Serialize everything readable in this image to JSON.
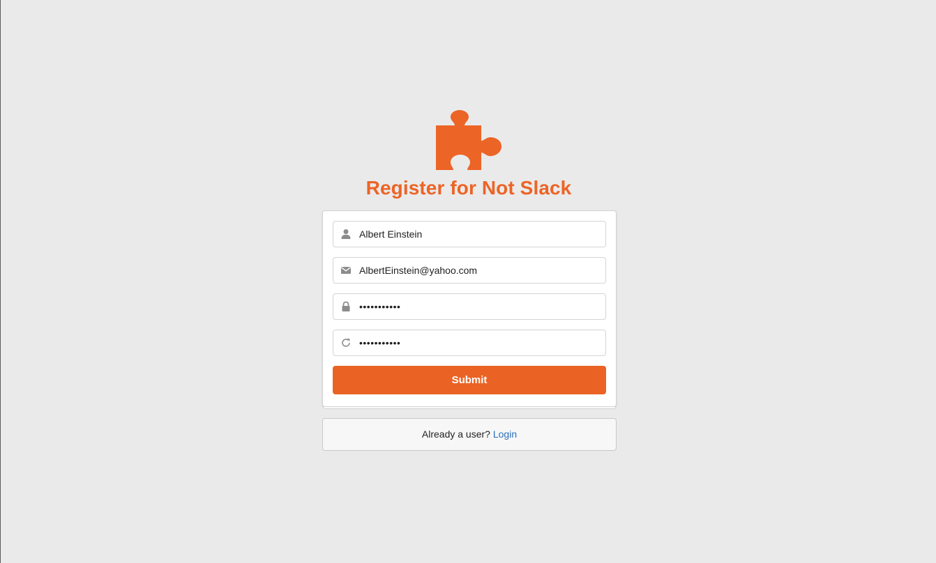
{
  "header": {
    "logo_icon": "puzzle-piece-icon",
    "title": "Register for Not Slack",
    "accent_color": "#ec6426"
  },
  "form": {
    "fields": [
      {
        "icon": "user-icon",
        "value": "Albert Einstein",
        "type": "text"
      },
      {
        "icon": "mail-icon",
        "value": "AlbertEinstein@yahoo.com",
        "type": "email"
      },
      {
        "icon": "lock-icon",
        "value": "•••••••••••",
        "type": "password"
      },
      {
        "icon": "repeat-icon",
        "value": "•••••••••••",
        "type": "password"
      }
    ],
    "submit_label": "Submit"
  },
  "footer": {
    "prompt": "Already a user?",
    "login_link": "Login",
    "link_color": "#2a6fb8"
  }
}
